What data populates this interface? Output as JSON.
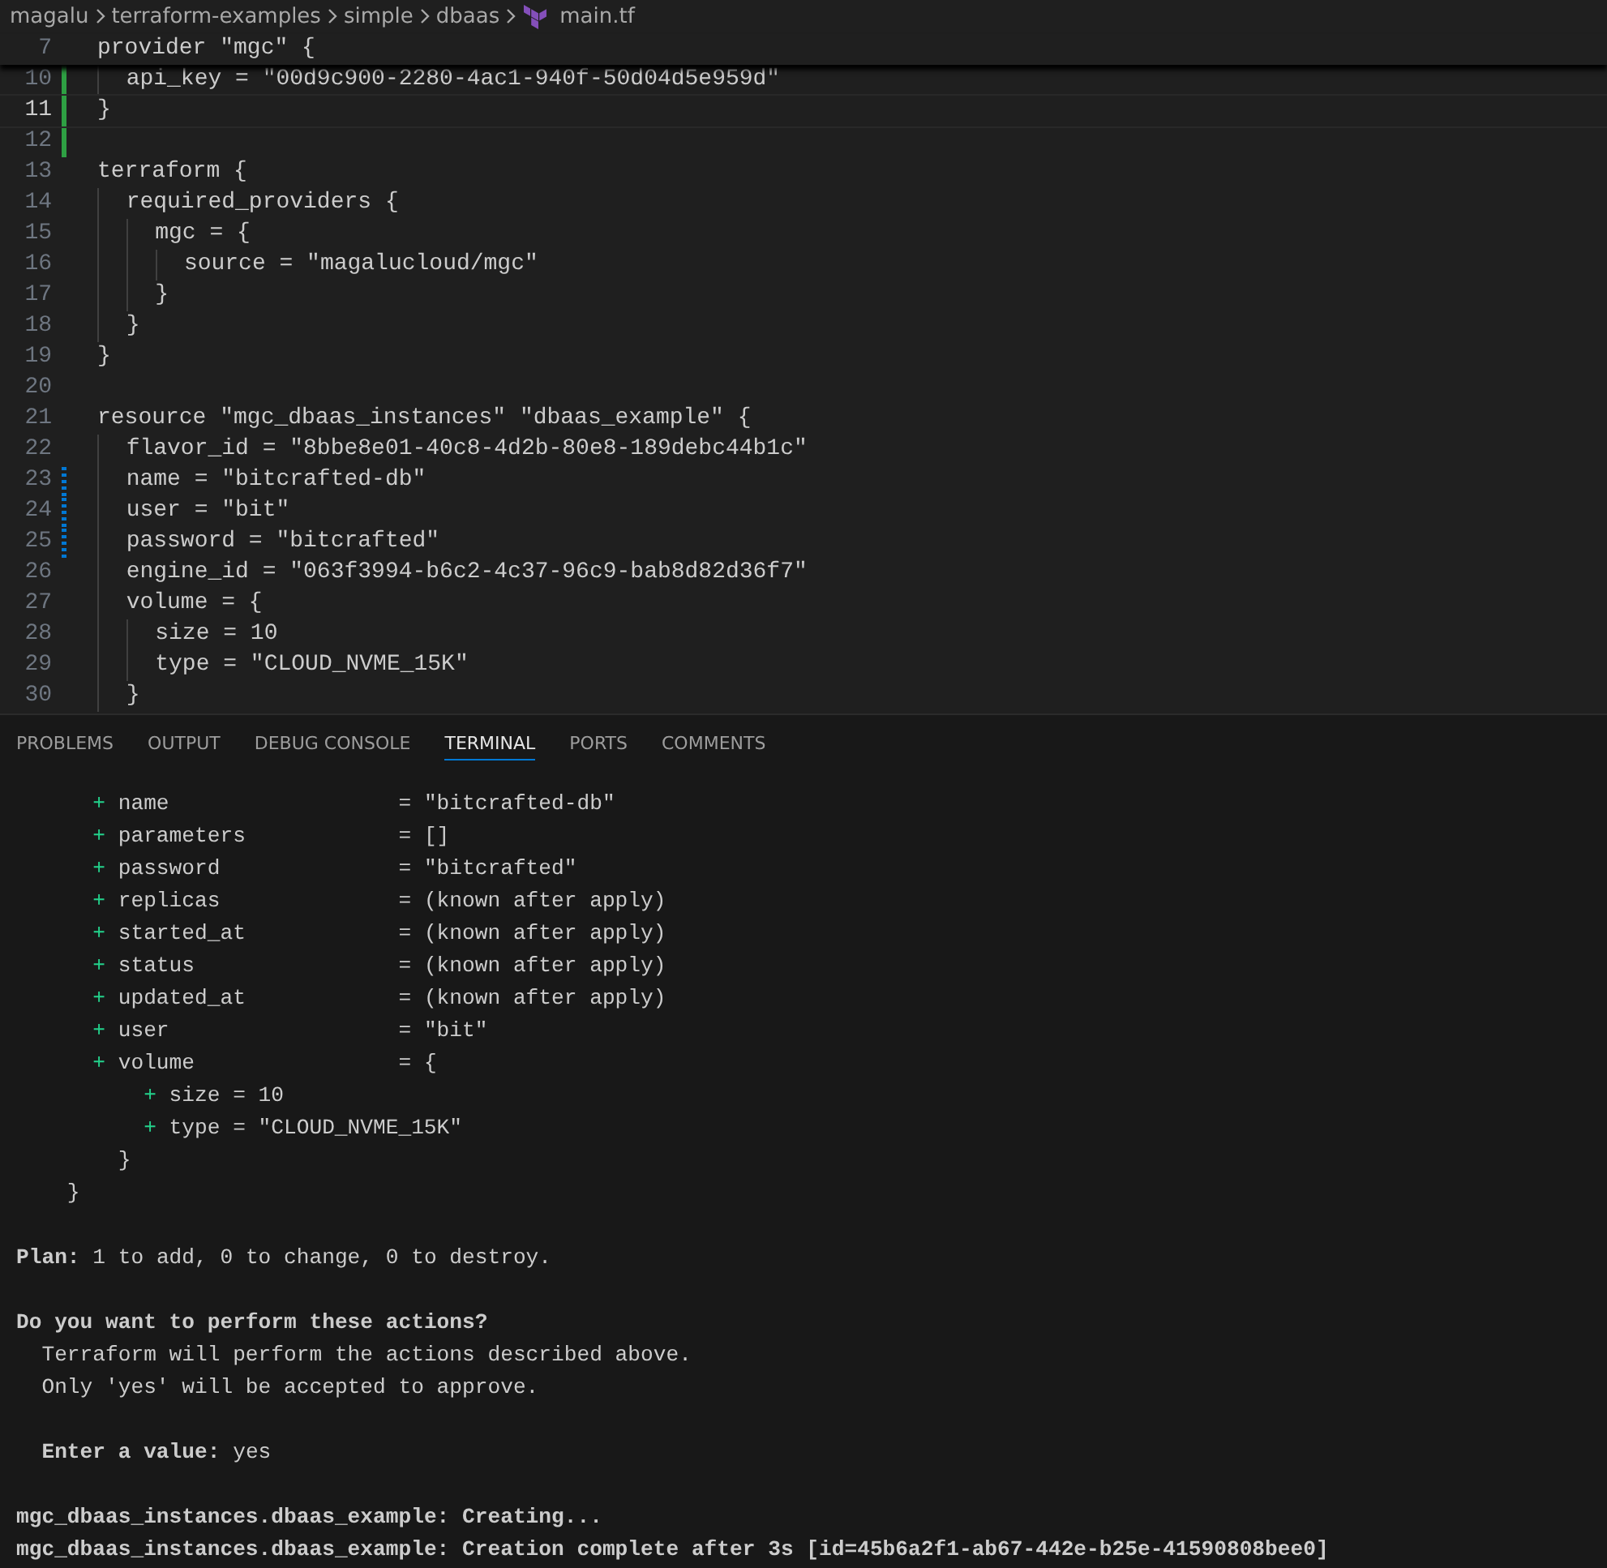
{
  "breadcrumb": [
    "magalu",
    "terraform-examples",
    "simple",
    "dbaas",
    "main.tf"
  ],
  "editor": {
    "sticky_line": {
      "number": "7",
      "text": "provider \"mgc\" {"
    },
    "lines": [
      {
        "number": "10",
        "text": "  api_key = \"00d9c900-2280-4ac1-940f-50d04d5e959d\"",
        "kind": "added",
        "current": false
      },
      {
        "number": "11",
        "text": "}",
        "kind": "added",
        "current": true
      },
      {
        "number": "12",
        "kind": "added",
        "current": false
      },
      {
        "number": "13",
        "text": "terraform {",
        "kind": "plain",
        "current": false
      },
      {
        "number": "14",
        "text": "  required_providers {",
        "kind": "plain",
        "current": false
      },
      {
        "number": "15",
        "text": "    mgc = {",
        "kind": "plain",
        "current": false
      },
      {
        "number": "16",
        "text": "      source = \"magalucloud/mgc\"",
        "kind": "plain",
        "current": false
      },
      {
        "number": "17",
        "text": "    }",
        "kind": "plain",
        "current": false
      },
      {
        "number": "18",
        "text": "  }",
        "kind": "plain",
        "current": false
      },
      {
        "number": "19",
        "text": "}",
        "kind": "plain",
        "current": false
      },
      {
        "number": "20",
        "kind": "plain",
        "current": false
      },
      {
        "number": "21",
        "text": "resource \"mgc_dbaas_instances\" \"dbaas_example\" {",
        "kind": "plain",
        "current": false
      },
      {
        "number": "22",
        "text": "  flavor_id = \"8bbe8e01-40c8-4d2b-80e8-189debc44b1c\"",
        "kind": "plain",
        "current": false
      },
      {
        "number": "23",
        "text": "  name = \"bitcrafted-db\"",
        "kind": "modified",
        "current": false
      },
      {
        "number": "24",
        "text": "  user = \"bit\"",
        "kind": "modified",
        "current": false
      },
      {
        "number": "25",
        "text": "  password = \"bitcrafted\"",
        "kind": "modified",
        "current": false
      },
      {
        "number": "26",
        "text": "  engine_id = \"063f3994-b6c2-4c37-96c9-bab8d82d36f7\"",
        "kind": "plain",
        "current": false
      },
      {
        "number": "27",
        "text": "  volume = {",
        "kind": "plain",
        "current": false
      },
      {
        "number": "28",
        "text": "    size = 10",
        "kind": "plain",
        "current": false
      },
      {
        "number": "29",
        "text": "    type = \"CLOUD_NVME_15K\"",
        "kind": "plain",
        "current": false
      },
      {
        "number": "30",
        "text": "  }",
        "kind": "plain",
        "current": false
      }
    ]
  },
  "panel_tabs": [
    {
      "label": "PROBLEMS",
      "selected": false
    },
    {
      "label": "OUTPUT",
      "selected": false
    },
    {
      "label": "DEBUG CONSOLE",
      "selected": false
    },
    {
      "label": "TERMINAL",
      "selected": true
    },
    {
      "label": "PORTS",
      "selected": false
    },
    {
      "label": "COMMENTS",
      "selected": false
    }
  ],
  "terminal": [
    {
      "kind": "added",
      "sign": "+",
      "text": "name                  = \"bitcrafted-db\"",
      "gap": false
    },
    {
      "kind": "added",
      "sign": "+",
      "text": "parameters            = []",
      "gap": false
    },
    {
      "kind": "added",
      "sign": "+",
      "text": "password              = \"bitcrafted\"",
      "gap": false
    },
    {
      "kind": "added",
      "sign": "+",
      "text": "replicas              = (known after apply)",
      "gap": false
    },
    {
      "kind": "added",
      "sign": "+",
      "text": "started_at            = (known after apply)",
      "gap": false
    },
    {
      "kind": "added",
      "sign": "+",
      "text": "status                = (known after apply)",
      "gap": false
    },
    {
      "kind": "added",
      "sign": "+",
      "text": "updated_at            = (known after apply)",
      "gap": false
    },
    {
      "kind": "added",
      "sign": "+",
      "text": "user                  = \"bit\"",
      "gap": false
    },
    {
      "kind": "added",
      "sign": "+",
      "text": "volume                = {",
      "gap": false,
      "children": [
        {
          "kind": "added",
          "sign": "+",
          "text": "size = 10",
          "gap": false
        },
        {
          "kind": "added",
          "sign": "+",
          "text": "type = \"CLOUD_NVME_15K\"",
          "gap": false
        }
      ]
    },
    {
      "kind": "plain",
      "text": "        }",
      "gap": false
    },
    {
      "kind": "plain",
      "text": "    }",
      "gap": false
    },
    {
      "kind": "plain",
      "text": "**Plan:** 1 to add, 0 to change, 0 to destroy.",
      "gap": true
    },
    {
      "kind": "bold",
      "text": "Do you want to perform these actions?",
      "gap": true
    },
    {
      "kind": "plain",
      "text": "  Terraform will perform the actions described above.",
      "gap": false
    },
    {
      "kind": "plain",
      "text": "  Only 'yes' will be accepted to approve.",
      "gap": false
    },
    {
      "kind": "plain",
      "text": "  **Enter a value:** yes",
      "gap": true
    },
    {
      "kind": "bold",
      "text": "mgc_dbaas_instances.dbaas_example: Creating...",
      "gap": true
    },
    {
      "kind": "bold",
      "text": "mgc_dbaas_instances.dbaas_example: Creation complete after 3s [id=45b6a2f1-ab67-442e-b25e-41590808bee0]",
      "gap": false
    }
  ]
}
